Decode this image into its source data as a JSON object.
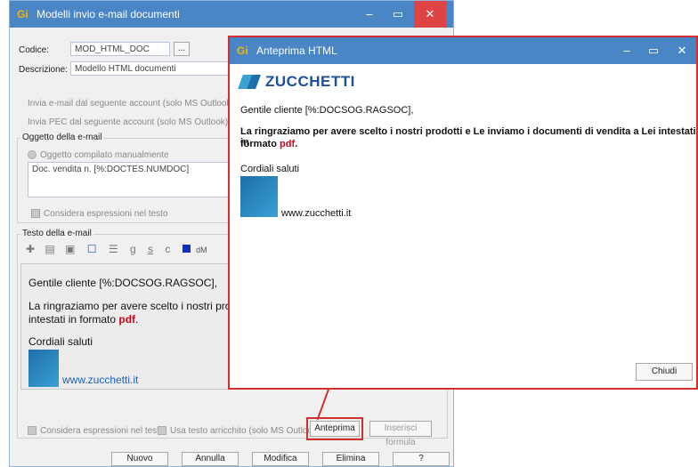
{
  "main_window": {
    "title": "Modelli invio e-mail documenti",
    "logo": "Gi",
    "controls": {
      "minimize": "–",
      "maximize": "▭",
      "close": "✕"
    },
    "codice_label": "Codice:",
    "codice_value": "MOD_HTML_DOC",
    "codice_btn": "...",
    "descrizione_label": "Descrizione:",
    "descrizione_value": "Modello HTML documenti",
    "account_label": "Invia e-mail dal seguente account (solo MS Outlook):",
    "pec_label": "Invia PEC dal seguente account (solo MS Outlook):",
    "oggetto_group": "Oggetto della e-mail",
    "oggetto_radio": "Oggetto compilato manualmente",
    "oggetto_value": "Doc. vendita n. [%:DOCTES.NUMDOC]",
    "considera_label": "Considera espressioni nel testo",
    "testo_group": "Testo della e-mail",
    "toolbar": {
      "b1": "✚",
      "b2": "▤",
      "b3": "▣",
      "b4": "☐",
      "b5": "☰",
      "g": "g",
      "s": "s",
      "c": "c",
      "font": "dM"
    },
    "body_greeting": "Gentile cliente [%:DOCSOG.RAGSOC],",
    "body_line1": "La ringraziamo per avere scelto i nostri prodot",
    "body_line2_pre": "intestati in formato ",
    "body_pdf": "pdf",
    "body_line2_post": ".",
    "body_closing": "Cordiali saluti",
    "body_link": "www.zucchetti.it",
    "considera_bottom": "Considera espressioni nel testo",
    "usa_testo": "Usa testo arricchito (solo MS Outlook)",
    "anteprima_btn": "Anteprima",
    "inserisci_btn": "Inserisci formula",
    "footer": {
      "nuovo": "Nuovo",
      "annulla": "Annulla",
      "modifica": "Modifica",
      "elimina": "Elimina",
      "help": "?"
    }
  },
  "preview_window": {
    "title": "Anteprima HTML",
    "logo": "Gi",
    "brand": "ZUCCHETTI",
    "controls": {
      "minimize": "–",
      "maximize": "▭",
      "close": "✕"
    },
    "greeting": "Gentile cliente [%:DOCSOG.RAGSOC],",
    "line1": "La ringraziamo per avere scelto i nostri prodotti e Le inviamo i documenti di vendita a Lei intestati in",
    "line2_pre": "formato ",
    "pdf": "pdf",
    "line2_post": ".",
    "closing": "Cordiali saluti",
    "link": "www.zucchetti.it",
    "chiudi_btn": "Chiudi"
  },
  "colors": {
    "titlebar": "#4a86c5",
    "highlight": "#d22f2f",
    "pdf": "#d0021b",
    "link": "#1a5fb4",
    "brand": "#1d4f9b"
  }
}
